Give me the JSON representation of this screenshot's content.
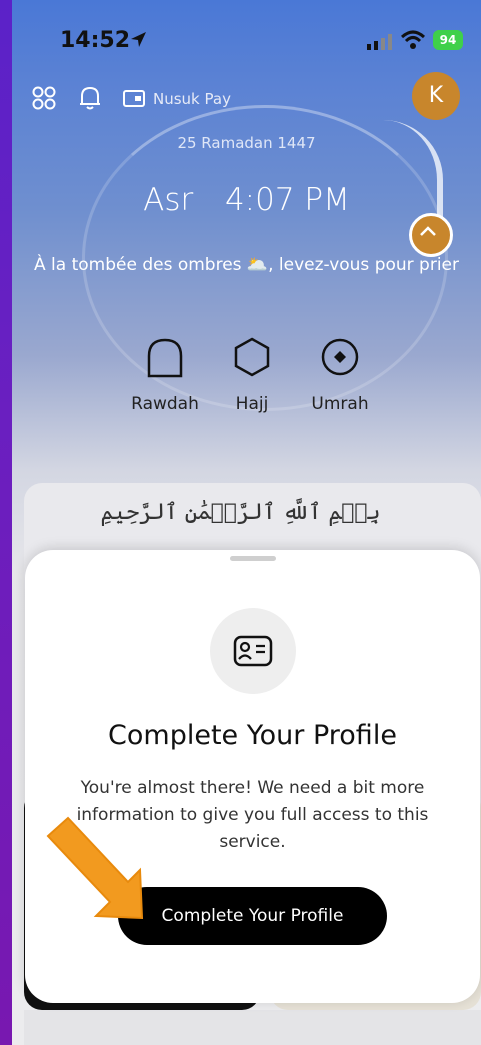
{
  "status_bar": {
    "time": "14:52",
    "battery": "94"
  },
  "app_bar": {
    "nusuk_pay_label": "Nusuk Pay",
    "avatar_letter": "K"
  },
  "hero": {
    "hijri_date": "25 Ramadan 1447",
    "prayer_name": "Asr",
    "prayer_time": "4:07 PM",
    "quote": "À la tombée des ombres 🌥️, levez-vous pour prier"
  },
  "quick_actions": [
    {
      "label": "Rawdah",
      "icon": "dome-icon"
    },
    {
      "label": "Hajj",
      "icon": "hexagon-icon"
    },
    {
      "label": "Umrah",
      "icon": "target-icon"
    }
  ],
  "card": {
    "bismillah": "بِسۡمِ ٱللَّهِ ٱلرَّحۡمَٰنِ ٱلرَّحِيمِ"
  },
  "sheet": {
    "icon": "id-card-icon",
    "title": "Complete Your Profile",
    "description": "You're almost there! We need a bit more information to give you full access to this service.",
    "button_label": "Complete Your Profile"
  },
  "colors": {
    "accent": "#c8862c",
    "button": "#000000",
    "frame": "#6a1fb0"
  }
}
